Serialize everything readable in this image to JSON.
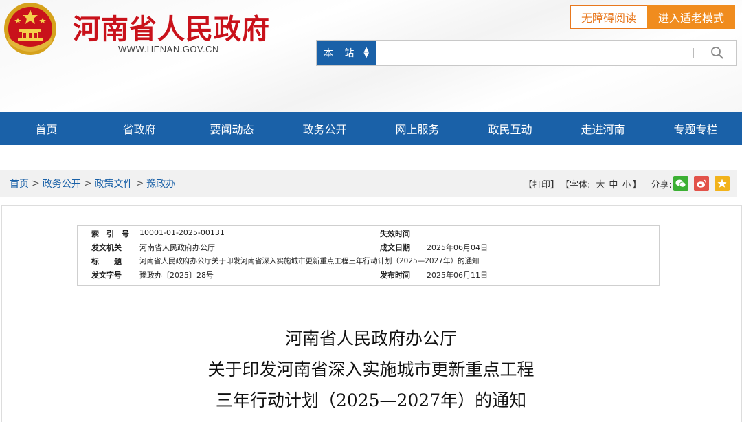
{
  "site": {
    "title": "河南省人民政府",
    "url": "WWW.HENAN.GOV.CN",
    "accessibility_label": "无障碍阅读",
    "elder_mode_label": "进入适老模式"
  },
  "search": {
    "scope_label": "本 站",
    "placeholder": ""
  },
  "nav": {
    "items": [
      "首页",
      "省政府",
      "要闻动态",
      "政务公开",
      "网上服务",
      "政民互动",
      "走进河南",
      "专题专栏"
    ]
  },
  "breadcrumb": {
    "items": [
      "首页",
      "政务公开",
      "政策文件",
      "豫政办"
    ],
    "separator": ">"
  },
  "tools": {
    "print": "【打印】",
    "font_prefix": "【字体:",
    "font_large": "大",
    "font_medium": "中",
    "font_small": "小",
    "font_suffix": "】",
    "share_label": "分享:"
  },
  "info": {
    "index_label": "索　引　号",
    "index_value": "10001-01-2025-00131",
    "expire_label": "失效时间",
    "expire_value": "",
    "issuer_label": "发文机关",
    "issuer_value": "河南省人民政府办公厅",
    "created_label": "成文日期",
    "created_value": "2025年06月04日",
    "title_label": "标　　题",
    "title_value": "河南省人民政府办公厅关于印发河南省深入实施城市更新重点工程三年行动计划（2025—2027年）的通知",
    "docno_label": "发文字号",
    "docno_value": "豫政办〔2025〕28号",
    "published_label": "发布时间",
    "published_value": "2025年06月11日"
  },
  "document": {
    "title_line1": "河南省人民政府办公厅",
    "title_line2": "关于印发河南省深入实施城市更新重点工程",
    "title_line3": "三年行动计划（2025—2027年）的通知"
  },
  "colors": {
    "brand_red": "#c9121b",
    "nav_blue": "#1a61a8",
    "accent_orange": "#f08c1e",
    "wechat_green": "#3cb034",
    "weibo_red": "#e2534a",
    "favorite_yellow": "#f2b31b"
  }
}
